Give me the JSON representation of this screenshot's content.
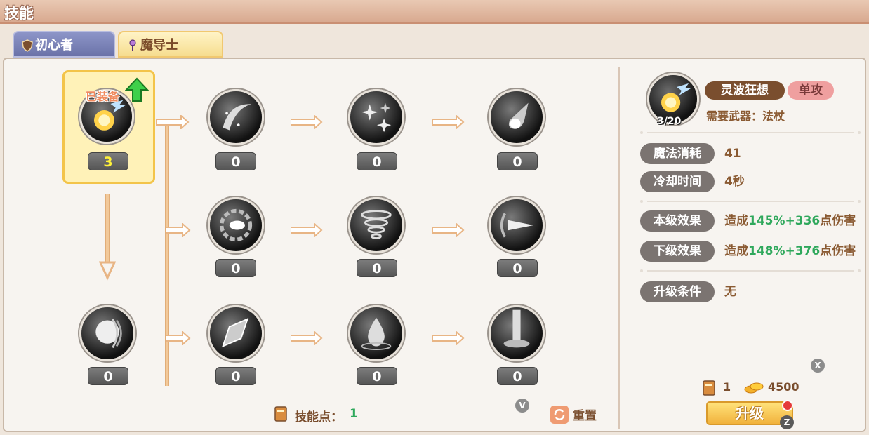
{
  "window": {
    "title": "技能"
  },
  "tabs": [
    {
      "label": "初心者",
      "icon": "shield-icon",
      "active": false
    },
    {
      "label": "魔导士",
      "icon": "wand-icon",
      "active": true
    }
  ],
  "tree": {
    "equipped_label": "已装备",
    "nodes": [
      {
        "id": "root",
        "level": "3",
        "icon": "spirit-wave-icon"
      },
      {
        "id": "r1c1",
        "level": "0",
        "icon": "moon-slash-icon"
      },
      {
        "id": "r1c2",
        "level": "0",
        "icon": "star-burst-icon"
      },
      {
        "id": "r1c3",
        "level": "0",
        "icon": "comet-icon"
      },
      {
        "id": "r2c1",
        "level": "0",
        "icon": "vortex-eye-icon"
      },
      {
        "id": "r2c2",
        "level": "0",
        "icon": "tornado-icon"
      },
      {
        "id": "r2c3",
        "level": "0",
        "icon": "drill-beam-icon"
      },
      {
        "id": "r3c0",
        "level": "0",
        "icon": "light-orb-icon"
      },
      {
        "id": "r3c1",
        "level": "0",
        "icon": "crystal-shard-icon"
      },
      {
        "id": "r3c2",
        "level": "0",
        "icon": "water-drop-icon"
      },
      {
        "id": "r3c3",
        "level": "0",
        "icon": "light-pillar-icon"
      }
    ]
  },
  "detail": {
    "icon": "spirit-wave-icon",
    "level_text": "3/20",
    "name": "灵波狂想",
    "type": "单攻",
    "weapon": "需要武器：法杖",
    "mana_label": "魔法消耗",
    "mana_value": "41",
    "cooldown_label": "冷却时间",
    "cooldown_value": "4秒",
    "current_label": "本级效果",
    "current_prefix": "造成",
    "current_highlight": "145%+336",
    "current_suffix": "点伤害",
    "next_label": "下级效果",
    "next_prefix": "造成",
    "next_highlight": "148%+376",
    "next_suffix": "点伤害",
    "req_label": "升级条件",
    "req_value": "无"
  },
  "footer": {
    "skill_points_label": "技能点：",
    "skill_points_value": "1",
    "key_v": "V",
    "reset_label": "重置",
    "key_x": "X",
    "cost_books": "1",
    "cost_gold": "4500",
    "upgrade_label": "升级",
    "key_z": "Z"
  },
  "colors": {
    "highlight_green": "#2fa85c",
    "brown_text": "#7a4e2e",
    "selected_border": "#f3c44a"
  }
}
